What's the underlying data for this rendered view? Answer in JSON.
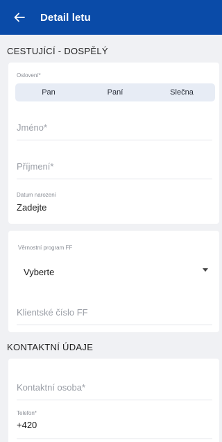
{
  "header": {
    "title": "Detail letu"
  },
  "passenger": {
    "section_title": "CESTUJÍCÍ - DOSPĚLÝ",
    "salutation": {
      "label": "Oslovení*",
      "options": [
        "Pan",
        "Paní",
        "Slečna"
      ]
    },
    "first_name": {
      "placeholder": "Jméno*"
    },
    "last_name": {
      "placeholder": "Příjmení*"
    },
    "birth_date": {
      "label": "Datum narození",
      "value": "Zadejte"
    }
  },
  "loyalty": {
    "label": "Věrnostní program FF",
    "selected": "Vyberte",
    "client_number": {
      "placeholder": "Klientské číslo FF"
    }
  },
  "contact": {
    "section_title": "KONTAKTNÍ ÚDAJE",
    "contact_person": {
      "placeholder": "Kontaktní osoba*"
    },
    "phone": {
      "label": "Telefon*",
      "value": "+420"
    }
  }
}
